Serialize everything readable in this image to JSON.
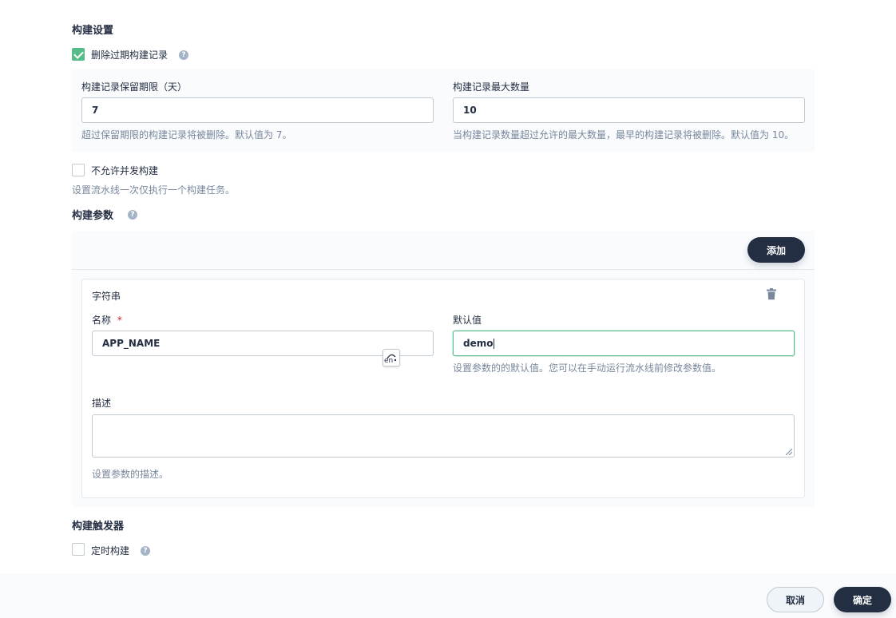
{
  "build_settings": {
    "title": "构建设置",
    "discard_old": {
      "label": "删除过期构建记录",
      "checked": true
    },
    "retention_days": {
      "label": "构建记录保留期限（天）",
      "value": "7",
      "desc": "超过保留期限的构建记录将被删除。默认值为 7。"
    },
    "max_count": {
      "label": "构建记录最大数量",
      "value": "10",
      "desc": "当构建记录数量超过允许的最大数量，最早的构建记录将被删除。默认值为 10。"
    },
    "no_concurrent": {
      "label": "不允许并发构建",
      "checked": false,
      "desc": "设置流水线一次仅执行一个构建任务。"
    }
  },
  "build_params": {
    "title": "构建参数",
    "add_label": "添加",
    "param": {
      "type": "字符串",
      "name_label": "名称",
      "required_mark": "*",
      "name_value": "APP_NAME",
      "default_label": "默认值",
      "default_value": "demo",
      "default_desc": "设置参数的的默认值。您可以在手动运行流水线前修改参数值。",
      "desc_label": "描述",
      "desc_value": "",
      "desc_help": "设置参数的描述。"
    },
    "ime_icon_text": "en"
  },
  "build_triggers": {
    "title": "构建触发器",
    "scheduled": {
      "label": "定时构建",
      "checked": false
    }
  },
  "footer": {
    "cancel_label": "取消",
    "ok_label": "确定"
  },
  "help_glyph": "?",
  "colors": {
    "accent_green": "#55bc8a",
    "dark": "#242e42",
    "muted": "#79879c"
  }
}
